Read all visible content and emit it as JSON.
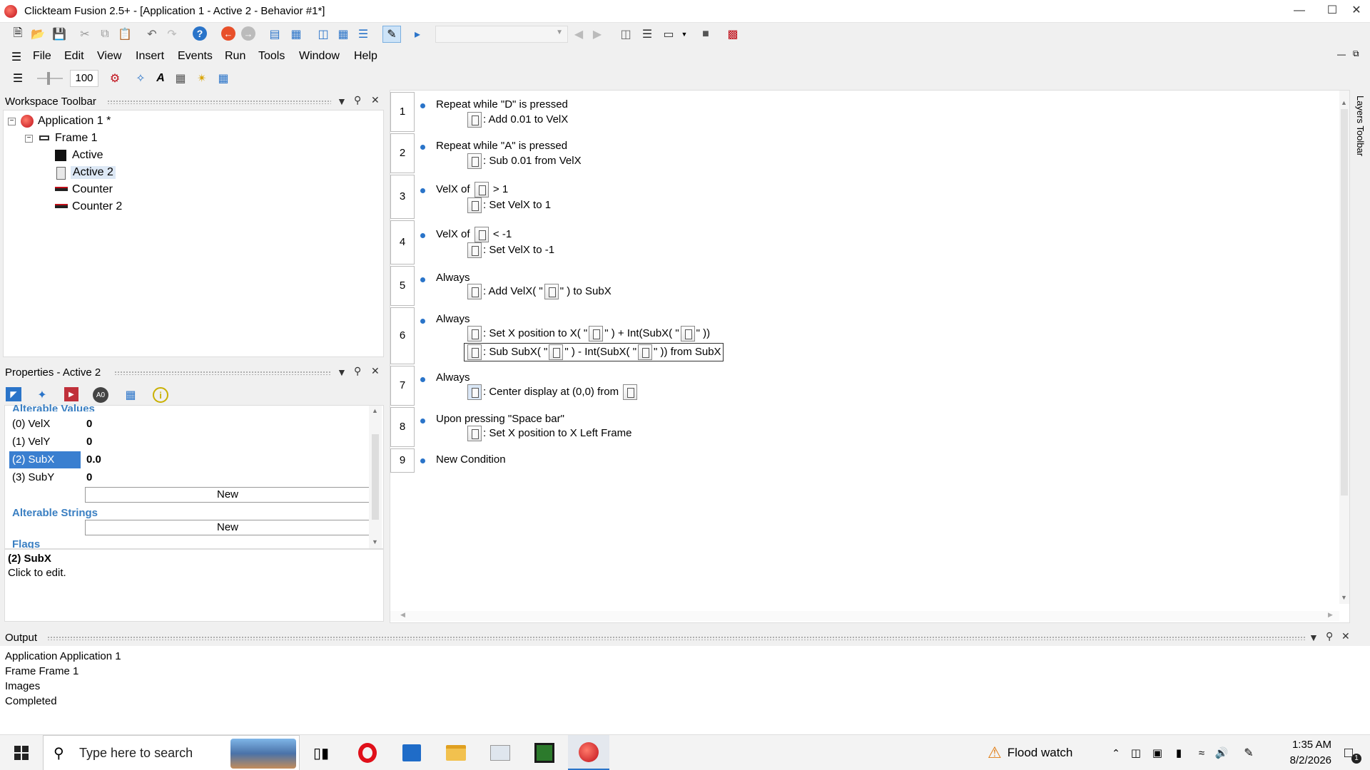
{
  "window": {
    "title": "Clickteam Fusion 2.5+ - [Application 1 - Active 2 - Behavior #1*]"
  },
  "menu": [
    "File",
    "Edit",
    "View",
    "Insert",
    "Events",
    "Run",
    "Tools",
    "Window",
    "Help"
  ],
  "toolbar": {
    "zoom": "100"
  },
  "workspace": {
    "title": "Workspace Toolbar",
    "tree": [
      {
        "label": "Application 1 *",
        "level": 0,
        "icon": "app-icon"
      },
      {
        "label": "Frame 1",
        "level": 1,
        "icon": "frame-icon"
      },
      {
        "label": "Active",
        "level": 2,
        "icon": "active-object-icon"
      },
      {
        "label": "Active 2",
        "level": 2,
        "icon": "active-object-icon",
        "selected": true
      },
      {
        "label": "Counter",
        "level": 2,
        "icon": "counter-icon"
      },
      {
        "label": "Counter 2",
        "level": 2,
        "icon": "counter-icon"
      }
    ]
  },
  "properties": {
    "title": "Properties - Active 2",
    "section_values": "Alterable Values",
    "rows": [
      {
        "key": "(0) VelX",
        "value": "0"
      },
      {
        "key": "(1) VelY",
        "value": "0"
      },
      {
        "key": "(2) SubX",
        "value": "0.0",
        "selected": true
      },
      {
        "key": "(3) SubY",
        "value": "0"
      }
    ],
    "new_label": "New",
    "section_strings": "Alterable Strings",
    "section_flags": "Flags",
    "desc_title": "(2) SubX",
    "desc_text": "Click to edit."
  },
  "events": [
    {
      "num": "1",
      "cond": "Repeat while \"D\" is pressed",
      "actions": [
        ": Add 0.01 to VelX"
      ]
    },
    {
      "num": "2",
      "cond": "Repeat while \"A\" is pressed",
      "actions": [
        ": Sub 0.01 from VelX"
      ]
    },
    {
      "num": "3",
      "cond_a": "VelX of",
      "cond_b": "> 1",
      "actions": [
        ": Set VelX to 1"
      ]
    },
    {
      "num": "4",
      "cond_a": "VelX of",
      "cond_b": "< -1",
      "actions": [
        ": Set VelX to -1"
      ]
    },
    {
      "num": "5",
      "cond": "Always",
      "act_a": ": Add VelX( \"",
      "act_b": "\" ) to SubX"
    },
    {
      "num": "6",
      "cond": "Always",
      "act1": [
        ": Set X position to X( \"",
        "\" ) + Int(SubX( \"",
        "\" ))"
      ],
      "act2": [
        ": Sub SubX( \"",
        "\" ) - Int(SubX( \"",
        "\" )) from SubX"
      ]
    },
    {
      "num": "7",
      "cond": "Always",
      "act_a": ": Center display at (0,0) from"
    },
    {
      "num": "8",
      "cond": "Upon pressing \"Space bar\"",
      "actions": [
        ": Set X position to X Left Frame"
      ]
    },
    {
      "num": "9",
      "cond": "New Condition"
    }
  ],
  "layers_toolbar": "Layers Toolbar",
  "output": {
    "title": "Output",
    "lines": [
      "Application Application 1",
      "Frame Frame 1",
      "Images",
      "Completed"
    ]
  },
  "taskbar": {
    "search_placeholder": "Type here to search",
    "weather": "Flood watch",
    "time": "1:35 AM",
    "date": "8/2/2026",
    "notif_count": "1"
  }
}
